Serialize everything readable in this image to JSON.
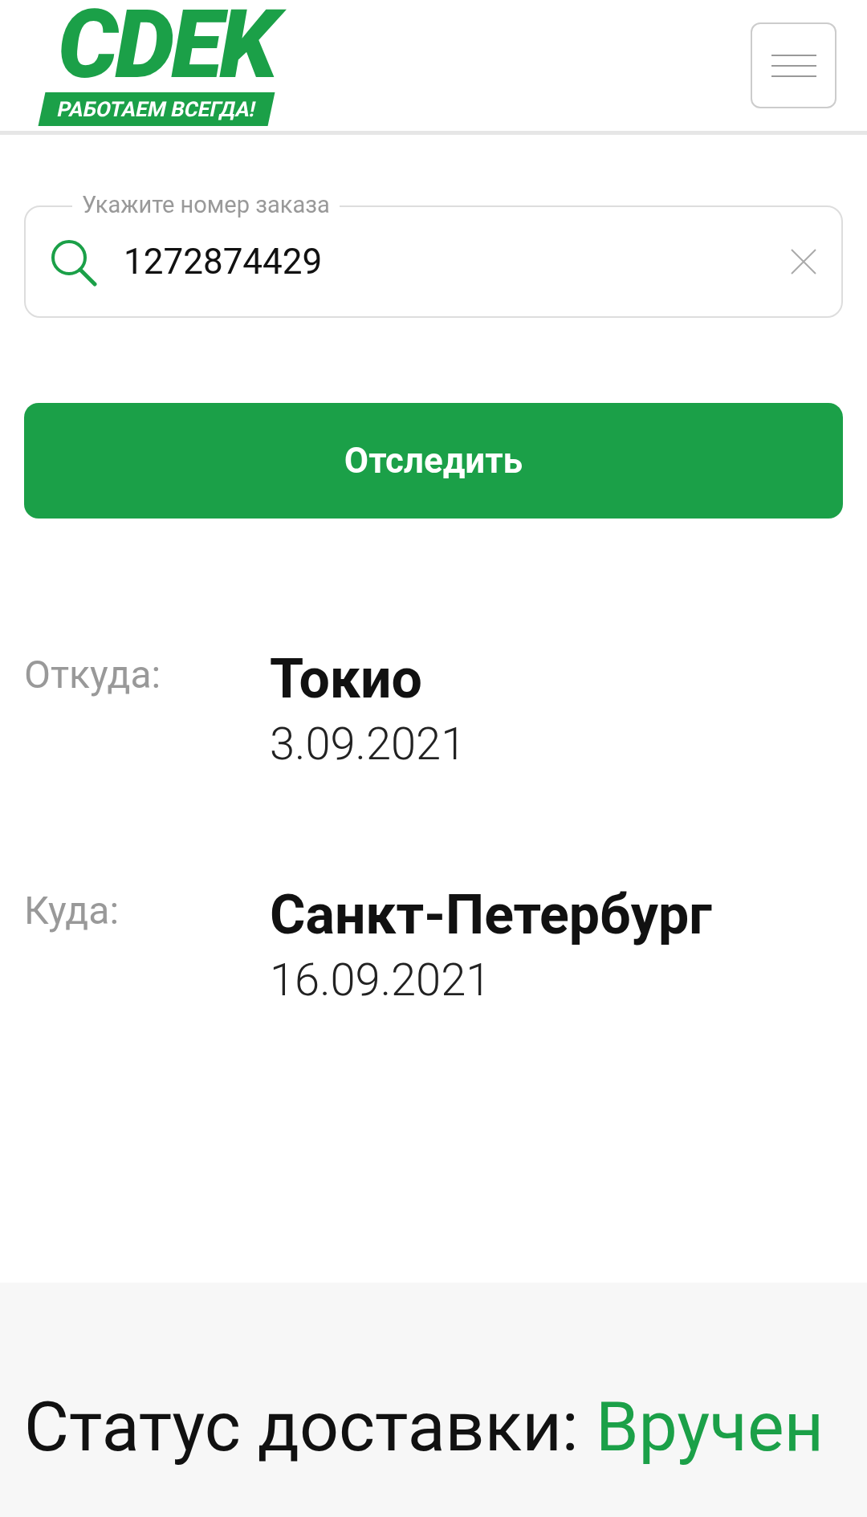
{
  "header": {
    "logo": "CDEK",
    "slogan": "РАБОТАЕМ ВСЕГДА!"
  },
  "search": {
    "label": "Укажите номер заказа",
    "value": "1272874429"
  },
  "track_button": "Отследить",
  "route": [
    {
      "label": "Откуда:",
      "city": "Токио",
      "date": "3.09.2021"
    },
    {
      "label": "Куда:",
      "city": "Санкт-Петербург",
      "date": "16.09.2021"
    }
  ],
  "status": {
    "label": "Статус доставки:",
    "value": "Вручен"
  }
}
